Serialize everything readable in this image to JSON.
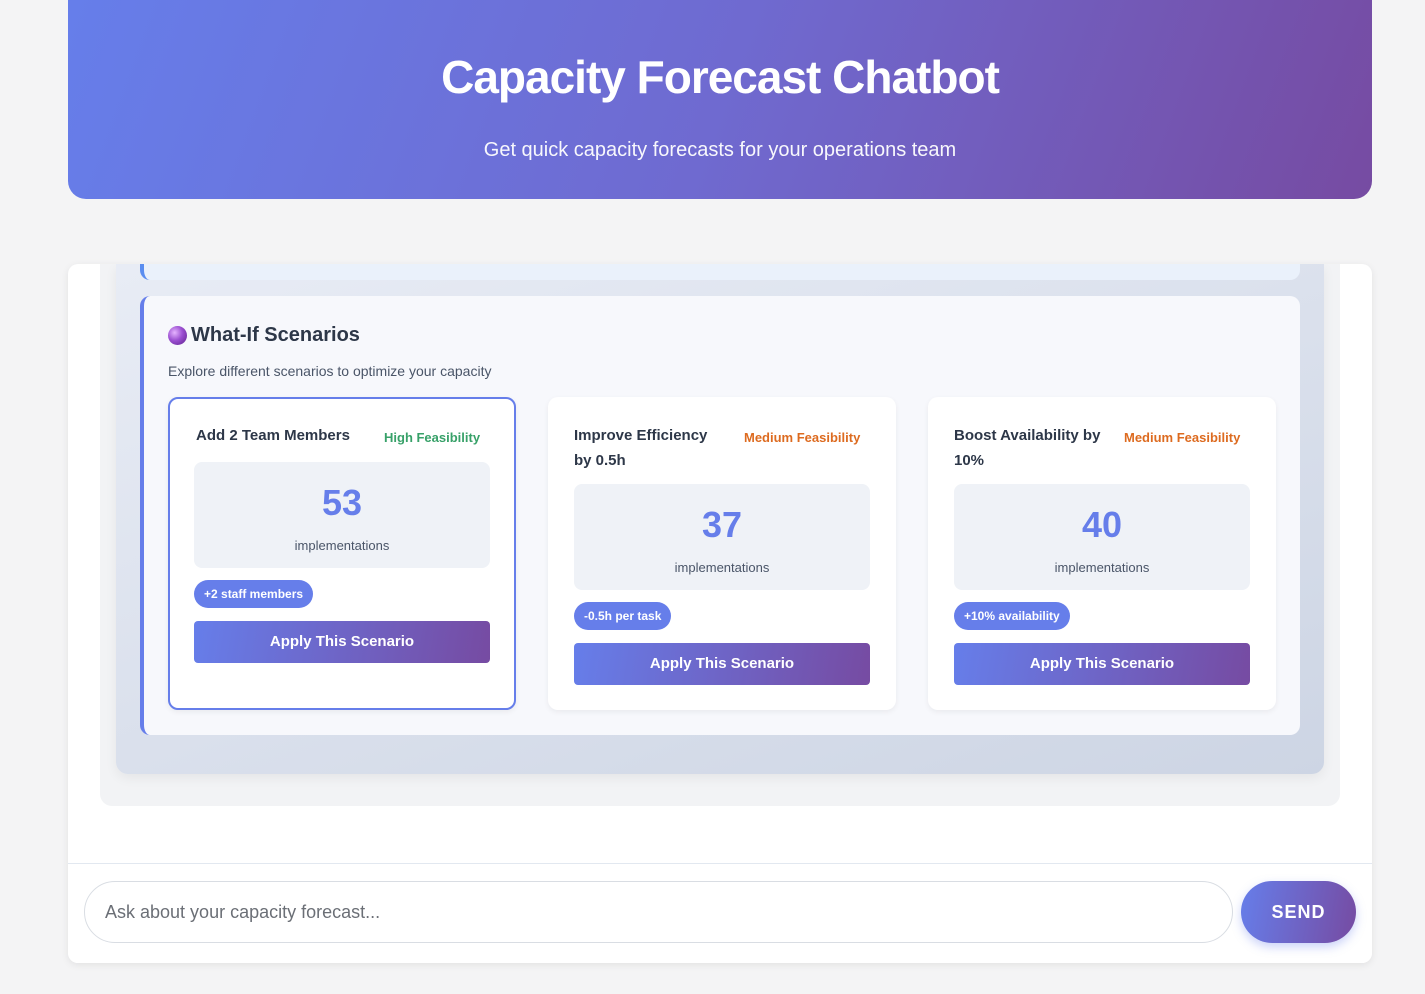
{
  "header": {
    "title": "Capacity Forecast Chatbot",
    "subtitle": "Get quick capacity forecasts for your operations team"
  },
  "scenarios": {
    "icon": "crystal-ball-icon",
    "title": "What-If Scenarios",
    "description": "Explore different scenarios to optimize your capacity",
    "cards": [
      {
        "name": "Add 2 Team Members",
        "feasibility": "High Feasibility",
        "value": "53",
        "unit": "implementations",
        "change": "+2 staff members",
        "button": "Apply This Scenario"
      },
      {
        "name": "Improve Efficiency by 0.5h",
        "feasibility": "Medium Feasibility",
        "value": "37",
        "unit": "implementations",
        "change": "-0.5h per task",
        "button": "Apply This Scenario"
      },
      {
        "name": "Boost Availability by 10%",
        "feasibility": "Medium Feasibility",
        "value": "40",
        "unit": "implementations",
        "change": "+10% availability",
        "button": "Apply This Scenario"
      }
    ]
  },
  "chat": {
    "placeholder": "Ask about your capacity forecast...",
    "send_label": "SEND"
  },
  "colors": {
    "accent": "#667eea",
    "accent_end": "#764ba2",
    "high_feasibility": "#38a169",
    "medium_feasibility": "#dd6b20"
  }
}
